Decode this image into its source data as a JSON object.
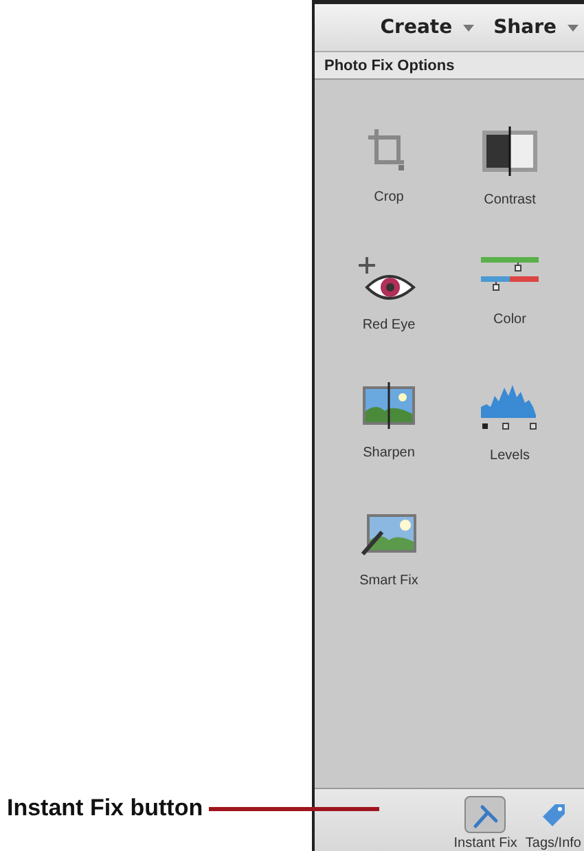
{
  "header": {
    "menus": [
      {
        "label": "Create"
      },
      {
        "label": "Share"
      }
    ]
  },
  "panel": {
    "title": "Photo Fix Options",
    "tools": [
      {
        "label": "Crop"
      },
      {
        "label": "Contrast"
      },
      {
        "label": "Red Eye"
      },
      {
        "label": "Color"
      },
      {
        "label": "Sharpen"
      },
      {
        "label": "Levels"
      },
      {
        "label": "Smart Fix"
      }
    ]
  },
  "bottom_bar": {
    "buttons": [
      {
        "label": "Instant Fix",
        "selected": true
      },
      {
        "label": "Tags/Info",
        "selected": false
      }
    ]
  },
  "callout": {
    "text": "Instant Fix button"
  }
}
